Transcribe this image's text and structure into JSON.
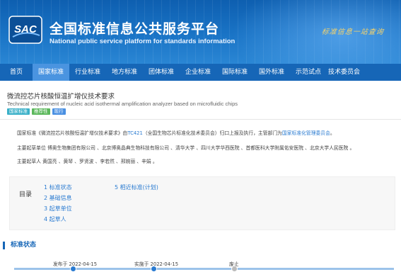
{
  "header": {
    "title_cn": "全国标准信息公共服务平台",
    "title_en": "National public service platform  for standards information",
    "slogan": "标准信息一站查询",
    "logo_text": "SAC"
  },
  "nav": {
    "items": [
      {
        "label": "首页",
        "active": false
      },
      {
        "label": "国家标准",
        "active": true
      },
      {
        "label": "行业标准",
        "active": false
      },
      {
        "label": "地方标准",
        "active": false
      },
      {
        "label": "团体标准",
        "active": false
      },
      {
        "label": "企业标准",
        "active": false
      },
      {
        "label": "国际标准",
        "active": false
      },
      {
        "label": "国外标准",
        "active": false
      },
      {
        "label": "示范试点",
        "active": false
      },
      {
        "label": "技术委员会",
        "active": false
      }
    ]
  },
  "standard": {
    "title": "微流控芯片核酸恒温扩增仪技术要求",
    "title_en": "Technical requirement of nucleic acid isothermal amplification analyzer based on microfluidic chips",
    "badges": [
      "国家标准",
      "推荐性",
      "现行"
    ],
    "desc_prefix": "国家标准《微流控芯片核酸恒温扩增仪技术要求》由",
    "desc_tc_link": "TC421",
    "desc_middle": "（全国生物芯片标准化技术委员会）归口上报及执行，主管部门为",
    "desc_dept_link": "国家标准化管理委员会",
    "desc_suffix": "。",
    "drafting_units": "主要起草单位 博奥生物集团有限公司 、北京博奥晶典生物科技有限公司 、清华大学 、四川大学华西医院 、首都医科大学附属佑安医院 、北京大学人民医院 。",
    "drafters": "主要起草人 黄国亮 、黄琴 、罗贤波 、李若然 、邢婉丽 、辛娟 。"
  },
  "toc": {
    "label": "目录",
    "col1": [
      "1  标准状态",
      "2  基础信息",
      "3  起草单位",
      "4  起草人"
    ],
    "col2": [
      "5  相近标准(计划)"
    ]
  },
  "status": {
    "title": "标准状态",
    "publish": "发布于 2022-04-15",
    "implement": "实施于 2022-04-15",
    "abolish": "废止"
  },
  "colors": {
    "brand_blue": "#1666b7",
    "nav_active": "#4a94e0",
    "link": "#2a7bd1"
  }
}
